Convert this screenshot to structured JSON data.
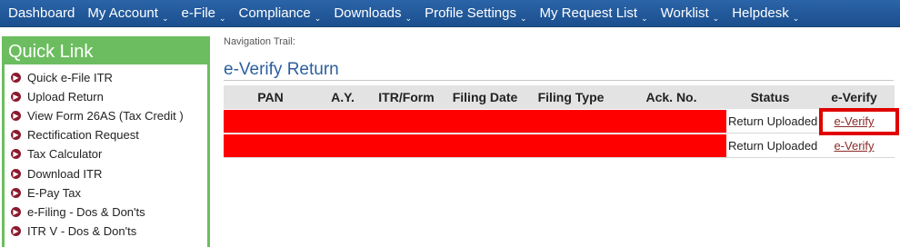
{
  "topnav": {
    "items": [
      {
        "label": "Dashboard",
        "caret": ""
      },
      {
        "label": "My Account",
        "caret": "⌄"
      },
      {
        "label": "e-File",
        "caret": "⌄"
      },
      {
        "label": "Compliance",
        "caret": "⌄"
      },
      {
        "label": "Downloads",
        "caret": "⌄"
      },
      {
        "label": "Profile Settings",
        "caret": "⌄"
      },
      {
        "label": "My Request List",
        "caret": "⌄"
      },
      {
        "label": "Worklist",
        "caret": "⌄"
      },
      {
        "label": "Helpdesk",
        "caret": "⌄"
      }
    ]
  },
  "quicklink": {
    "title": "Quick Link",
    "items": [
      "Quick e-File ITR",
      "Upload Return",
      "View Form 26AS (Tax Credit )",
      "Rectification Request",
      "Tax Calculator",
      "Download ITR",
      "E-Pay Tax",
      "e-Filing - Dos & Don'ts",
      "ITR V - Dos & Don'ts"
    ]
  },
  "main": {
    "nav_trail": "Navigation Trail:",
    "title": "e-Verify Return",
    "columns": [
      "PAN",
      "A.Y.",
      "ITR/Form",
      "Filing Date",
      "Filing Type",
      "Ack. No.",
      "Status",
      "e-Verify"
    ],
    "rows": [
      {
        "status": "Return Uploaded",
        "action": "e-Verify",
        "highlighted": true
      },
      {
        "status": "Return Uploaded",
        "action": "e-Verify",
        "highlighted": false
      }
    ]
  },
  "colors": {
    "nav_bg": "#1f5596",
    "quicklink_green": "#6cbd5f",
    "redaction": "#ff0000",
    "highlight_border": "#e00000"
  }
}
